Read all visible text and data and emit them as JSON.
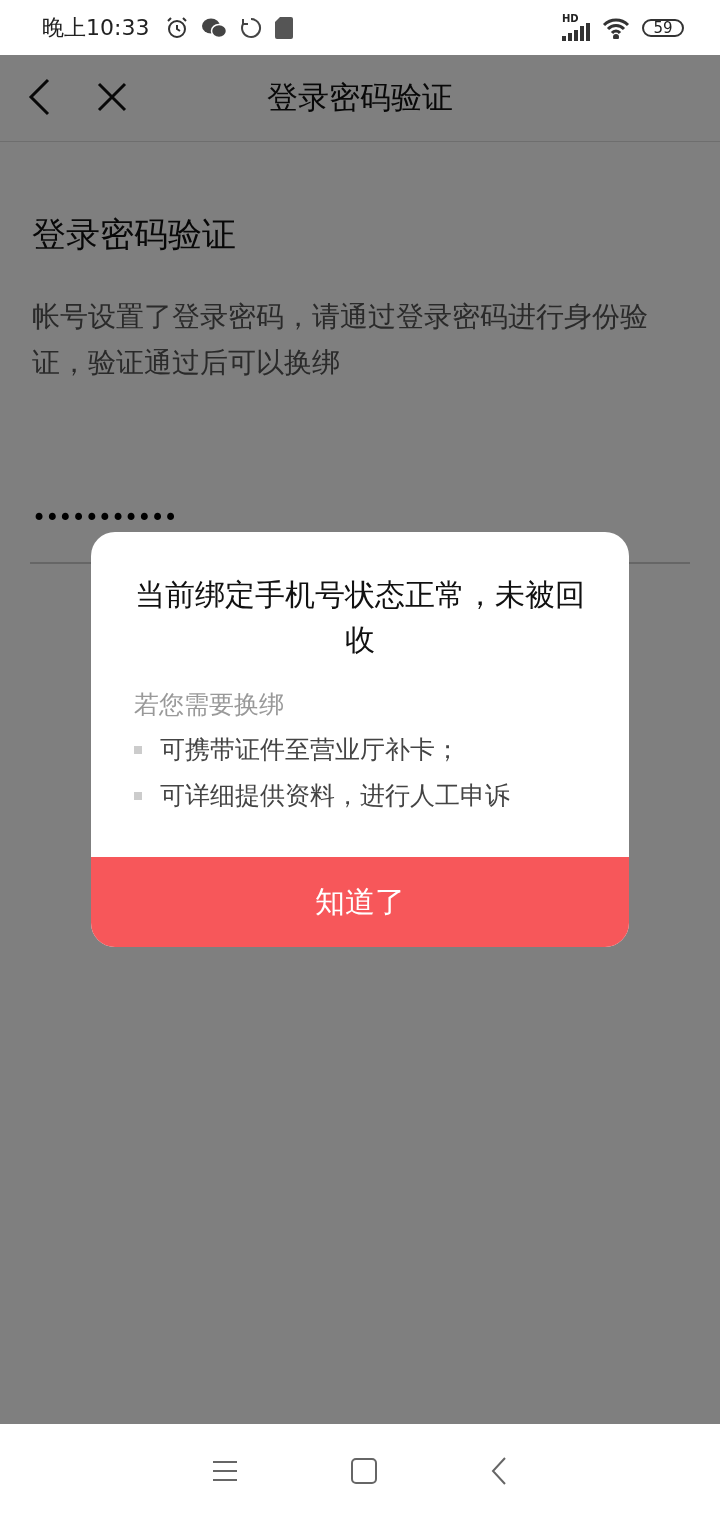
{
  "status_bar": {
    "time": "晚上10:33",
    "signal_label": "HD",
    "battery": "59"
  },
  "header": {
    "title": "登录密码验证"
  },
  "page": {
    "heading": "登录密码验证",
    "description": "帐号设置了登录密码，请通过登录密码进行身份验证，验证通过后可以换绑",
    "password": "•••••••••••"
  },
  "dialog": {
    "title": "当前绑定手机号状态正常，未被回收",
    "subtitle": "若您需要换绑",
    "bullets": [
      "可携带证件至营业厅补卡；",
      "可详细提供资料，进行人工申诉"
    ],
    "button": "知道了"
  }
}
